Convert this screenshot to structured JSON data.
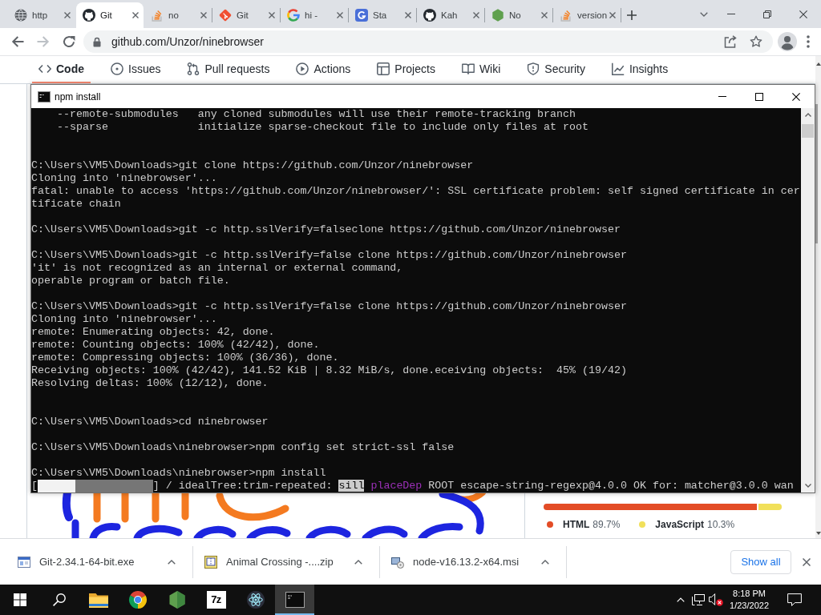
{
  "browser": {
    "tabs": [
      {
        "kind": "globe",
        "title": "http",
        "selected": false
      },
      {
        "kind": "cat",
        "title": "Git",
        "selected": true
      },
      {
        "kind": "trays",
        "title": "no",
        "selected": false
      },
      {
        "kind": "diamond",
        "title": "Git",
        "selected": false
      },
      {
        "kind": "letter-g",
        "title": "hi -",
        "selected": false
      },
      {
        "kind": "square-g",
        "title": "Sta",
        "selected": false
      },
      {
        "kind": "cat",
        "title": "Kah",
        "selected": false
      },
      {
        "kind": "hexagon",
        "title": "No",
        "selected": false
      },
      {
        "kind": "trays",
        "title": "version",
        "selected": false
      }
    ],
    "nav_buttons": [
      {
        "kind": "back",
        "disabled": false
      },
      {
        "kind": "forward",
        "disabled": true
      },
      {
        "kind": "reload",
        "disabled": false
      }
    ],
    "address": {
      "value": "github.com/Unzor/ninebrowser"
    }
  },
  "repo_nav": [
    {
      "kind": "code",
      "label": "Code",
      "selected": true
    },
    {
      "kind": "issues",
      "label": "Issues",
      "selected": false
    },
    {
      "kind": "pulls",
      "label": "Pull requests",
      "selected": false
    },
    {
      "kind": "actions",
      "label": "Actions",
      "selected": false
    },
    {
      "kind": "projects",
      "label": "Projects",
      "selected": false
    },
    {
      "kind": "wiki",
      "label": "Wiki",
      "selected": false
    },
    {
      "kind": "security",
      "label": "Security",
      "selected": false
    },
    {
      "kind": "insights",
      "label": "Insights",
      "selected": false
    }
  ],
  "languages": [
    {
      "name": "HTML",
      "share": "89.7%",
      "level": 0.897,
      "color": "#e34c26"
    },
    {
      "name": "JavaScript",
      "share": "10.3%",
      "level": 0.103,
      "color": "#f1e05a"
    }
  ],
  "terminal": {
    "title": "npm install",
    "lines": [
      {
        "kind": "text",
        "text": "    --remote-submodules   any cloned submodules will use their remote-tracking branch"
      },
      {
        "kind": "text",
        "text": "    --sparse              initialize sparse-checkout file to include only files at root"
      },
      {
        "kind": "blank"
      },
      {
        "kind": "blank"
      },
      {
        "kind": "text",
        "text": "C:\\Users\\VM5\\Downloads>git clone https://github.com/Unzor/ninebrowser"
      },
      {
        "kind": "text",
        "text": "Cloning into 'ninebrowser'..."
      },
      {
        "kind": "text",
        "text": "fatal: unable to access 'https://github.com/Unzor/ninebrowser/': SSL certificate problem: self signed certificate in cer"
      },
      {
        "kind": "text",
        "text": "tificate chain"
      },
      {
        "kind": "blank"
      },
      {
        "kind": "text",
        "text": "C:\\Users\\VM5\\Downloads>git -c http.sslVerify=falseclone https://github.com/Unzor/ninebrowser"
      },
      {
        "kind": "blank"
      },
      {
        "kind": "text",
        "text": "C:\\Users\\VM5\\Downloads>git -c http.sslVerify=false clone https://github.com/Unzor/ninebrowser"
      },
      {
        "kind": "text",
        "text": "'it' is not recognized as an internal or external command,"
      },
      {
        "kind": "text",
        "text": "operable program or batch file."
      },
      {
        "kind": "blank"
      },
      {
        "kind": "text",
        "text": "C:\\Users\\VM5\\Downloads>git -c http.sslVerify=false clone https://github.com/Unzor/ninebrowser"
      },
      {
        "kind": "text",
        "text": "Cloning into 'ninebrowser'..."
      },
      {
        "kind": "text",
        "text": "remote: Enumerating objects: 42, done."
      },
      {
        "kind": "text",
        "text": "remote: Counting objects: 100% (42/42), done."
      },
      {
        "kind": "text",
        "text": "remote: Compressing objects: 100% (36/36), done."
      },
      {
        "kind": "text",
        "text": "Receiving objects: 100% (42/42), 141.52 KiB | 8.32 MiB/s, done.eceiving objects:  45% (19/42)"
      },
      {
        "kind": "text",
        "text": "Resolving deltas: 100% (12/12), done."
      },
      {
        "kind": "blank"
      },
      {
        "kind": "blank"
      },
      {
        "kind": "text",
        "text": "C:\\Users\\VM5\\Downloads>cd ninebrowser"
      },
      {
        "kind": "blank"
      },
      {
        "kind": "text",
        "text": "C:\\Users\\VM5\\Downloads\\ninebrowser>npm config set strict-ssl false"
      },
      {
        "kind": "blank"
      },
      {
        "kind": "text",
        "text": "C:\\Users\\VM5\\Downloads\\ninebrowser>npm install"
      },
      {
        "kind": "progress",
        "prefix": "[",
        "level": 0.33,
        "suffix": "] / idealTree:trim-repeated:",
        "log_level": "sill",
        "tag": "placeDep",
        "message": "ROOT escape-string-regexp@4.0.0 OK for: matcher@3.0.0 wan"
      }
    ]
  },
  "downloads": {
    "items": [
      {
        "kind": "exe",
        "name": "Git-2.34.1-64-bit.exe"
      },
      {
        "kind": "zip",
        "name": "Animal Crossing -....zip"
      },
      {
        "kind": "msi",
        "name": "node-v16.13.2-x64.msi"
      }
    ],
    "show_all": "Show all"
  },
  "taskbar": {
    "apps": [
      {
        "kind": "start",
        "selected": false
      },
      {
        "kind": "search",
        "selected": false
      },
      {
        "kind": "folder",
        "selected": false
      },
      {
        "kind": "ball",
        "selected": false
      },
      {
        "kind": "hexagon",
        "selected": false
      },
      {
        "kind": "archive",
        "label": "7z",
        "selected": false
      },
      {
        "kind": "atom",
        "selected": false
      },
      {
        "kind": "terminal",
        "selected": true
      }
    ],
    "clock": {
      "time": "8:18 PM",
      "date": "1/23/2022"
    }
  }
}
